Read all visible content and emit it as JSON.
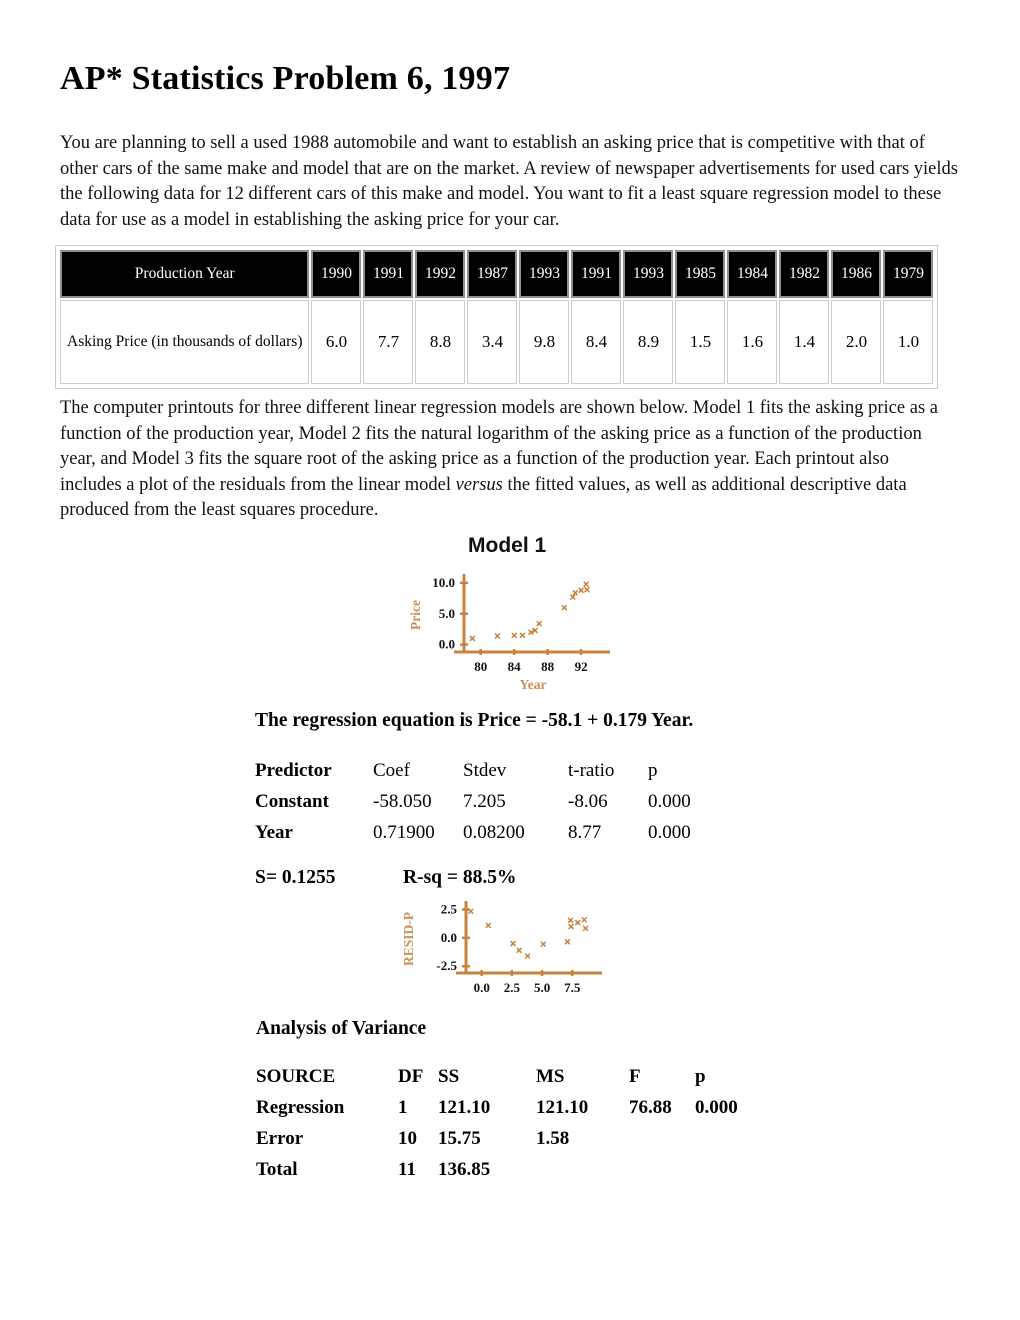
{
  "document": {
    "title": "AP* Statistics Problem 6, 1997",
    "paragraph_1": "You are planning to sell a used 1988 automobile and want to establish an asking price that is competitive with that of other cars of the same make and model that are on the market. A review of newspaper advertisements for used cars yields the following data for 12 different cars of this make and model. You want to fit a least square regression model to these data for use as a model in establishing the asking price for your car.",
    "paragraph_2_part1": "The computer printouts for three different linear regression models are shown below. Model 1 fits the asking price as a function of the production year, Model 2 fits the natural logarithm of the asking price as a function of the production year, and Model 3 fits the square root of the asking price as a function of the production year. Each printout also includes a plot of the residuals from the linear model ",
    "paragraph_2_italic": "versus",
    "paragraph_2_part2": " the fitted values, as well as additional descriptive data produced from the least squares procedure."
  },
  "data_table": {
    "row_labels": [
      "Production Year",
      "Asking Price (in thousands of dollars)"
    ],
    "years": [
      "1990",
      "1991",
      "1992",
      "1987",
      "1993",
      "1991",
      "1993",
      "1985",
      "1984",
      "1982",
      "1986",
      "1979"
    ],
    "prices": [
      "6.0",
      "7.7",
      "8.8",
      "3.4",
      "9.8",
      "8.4",
      "8.9",
      "1.5",
      "1.6",
      "1.4",
      "2.0",
      "1.0"
    ]
  },
  "model1": {
    "title": "Model 1",
    "regression_equation": "The regression equation is Price = -58.1 + 0.179 Year.",
    "coef_headers": [
      "Predictor",
      "Coef",
      "Stdev",
      "t-ratio",
      "p"
    ],
    "coef_rows": [
      {
        "predictor": "Constant",
        "coef": "-58.050",
        "stdev": "7.205",
        "t_ratio": "-8.06",
        "p": "0.000"
      },
      {
        "predictor": "Year",
        "coef": "0.71900",
        "stdev": "0.08200",
        "t_ratio": "8.77",
        "p": "0.000"
      }
    ],
    "s_value": "S= 0.1255",
    "rsq_value": "R-sq = 88.5%",
    "anova_title": "Analysis of Variance",
    "anova_headers": [
      "SOURCE",
      "DF",
      "SS",
      "MS",
      "F",
      "p"
    ],
    "anova_rows": [
      {
        "source": "Regression",
        "df": "1",
        "ss": "121.10",
        "ms": "121.10",
        "f": "76.88",
        "p": "0.000"
      },
      {
        "source": "Error",
        "df": "10",
        "ss": "15.75",
        "ms": "1.58",
        "f": "",
        "p": ""
      },
      {
        "source": "Total",
        "df": "11",
        "ss": "136.85",
        "ms": "",
        "f": "",
        "p": ""
      }
    ]
  },
  "chart_data": [
    {
      "id": "scatter",
      "type": "scatter",
      "title": "Model 1",
      "xlabel": "Year",
      "ylabel": "Price",
      "xticks": [
        80,
        84,
        88,
        92
      ],
      "yticks": [
        0.0,
        5.0,
        10.0
      ],
      "xlim": [
        78,
        94.5
      ],
      "ylim": [
        -1.2,
        10.8
      ],
      "grid": false,
      "marker": "x",
      "color": "#c8823c",
      "axis_color": "#c8823c",
      "tick_label_color": "#111111",
      "axis_label_color": "#c8915a",
      "points": [
        {
          "x": 79,
          "y": 1.0
        },
        {
          "x": 82,
          "y": 1.4
        },
        {
          "x": 84,
          "y": 1.5
        },
        {
          "x": 85,
          "y": 1.5
        },
        {
          "x": 86,
          "y": 2.0
        },
        {
          "x": 86.5,
          "y": 2.3
        },
        {
          "x": 87,
          "y": 3.4
        },
        {
          "x": 90,
          "y": 6.0
        },
        {
          "x": 91,
          "y": 7.7
        },
        {
          "x": 91.3,
          "y": 8.4
        },
        {
          "x": 92,
          "y": 8.8
        },
        {
          "x": 92.6,
          "y": 9.8
        },
        {
          "x": 92.7,
          "y": 8.9
        }
      ]
    },
    {
      "id": "residual",
      "type": "scatter",
      "title": "",
      "xlabel": "",
      "ylabel": "RESID-P",
      "xticks": [
        0.0,
        2.5,
        5.0,
        7.5
      ],
      "yticks": [
        -2.5,
        0.0,
        2.5
      ],
      "xlim": [
        -1.3,
        9.3
      ],
      "ylim": [
        -3.1,
        2.9
      ],
      "grid": false,
      "marker": "x",
      "color": "#c8823c",
      "axis_color": "#c8823c",
      "tick_label_color": "#111111",
      "axis_label_color": "#c8915a",
      "points": [
        {
          "x": -0.9,
          "y": 2.35
        },
        {
          "x": 0.55,
          "y": 1.1
        },
        {
          "x": 2.6,
          "y": -0.5
        },
        {
          "x": 3.1,
          "y": -1.1
        },
        {
          "x": 3.8,
          "y": -1.6
        },
        {
          "x": 5.1,
          "y": -0.55
        },
        {
          "x": 7.1,
          "y": -0.35
        },
        {
          "x": 7.35,
          "y": 1.55
        },
        {
          "x": 7.4,
          "y": 1.0
        },
        {
          "x": 7.95,
          "y": 1.35
        },
        {
          "x": 8.5,
          "y": 1.6
        },
        {
          "x": 8.6,
          "y": 0.85
        }
      ]
    }
  ]
}
